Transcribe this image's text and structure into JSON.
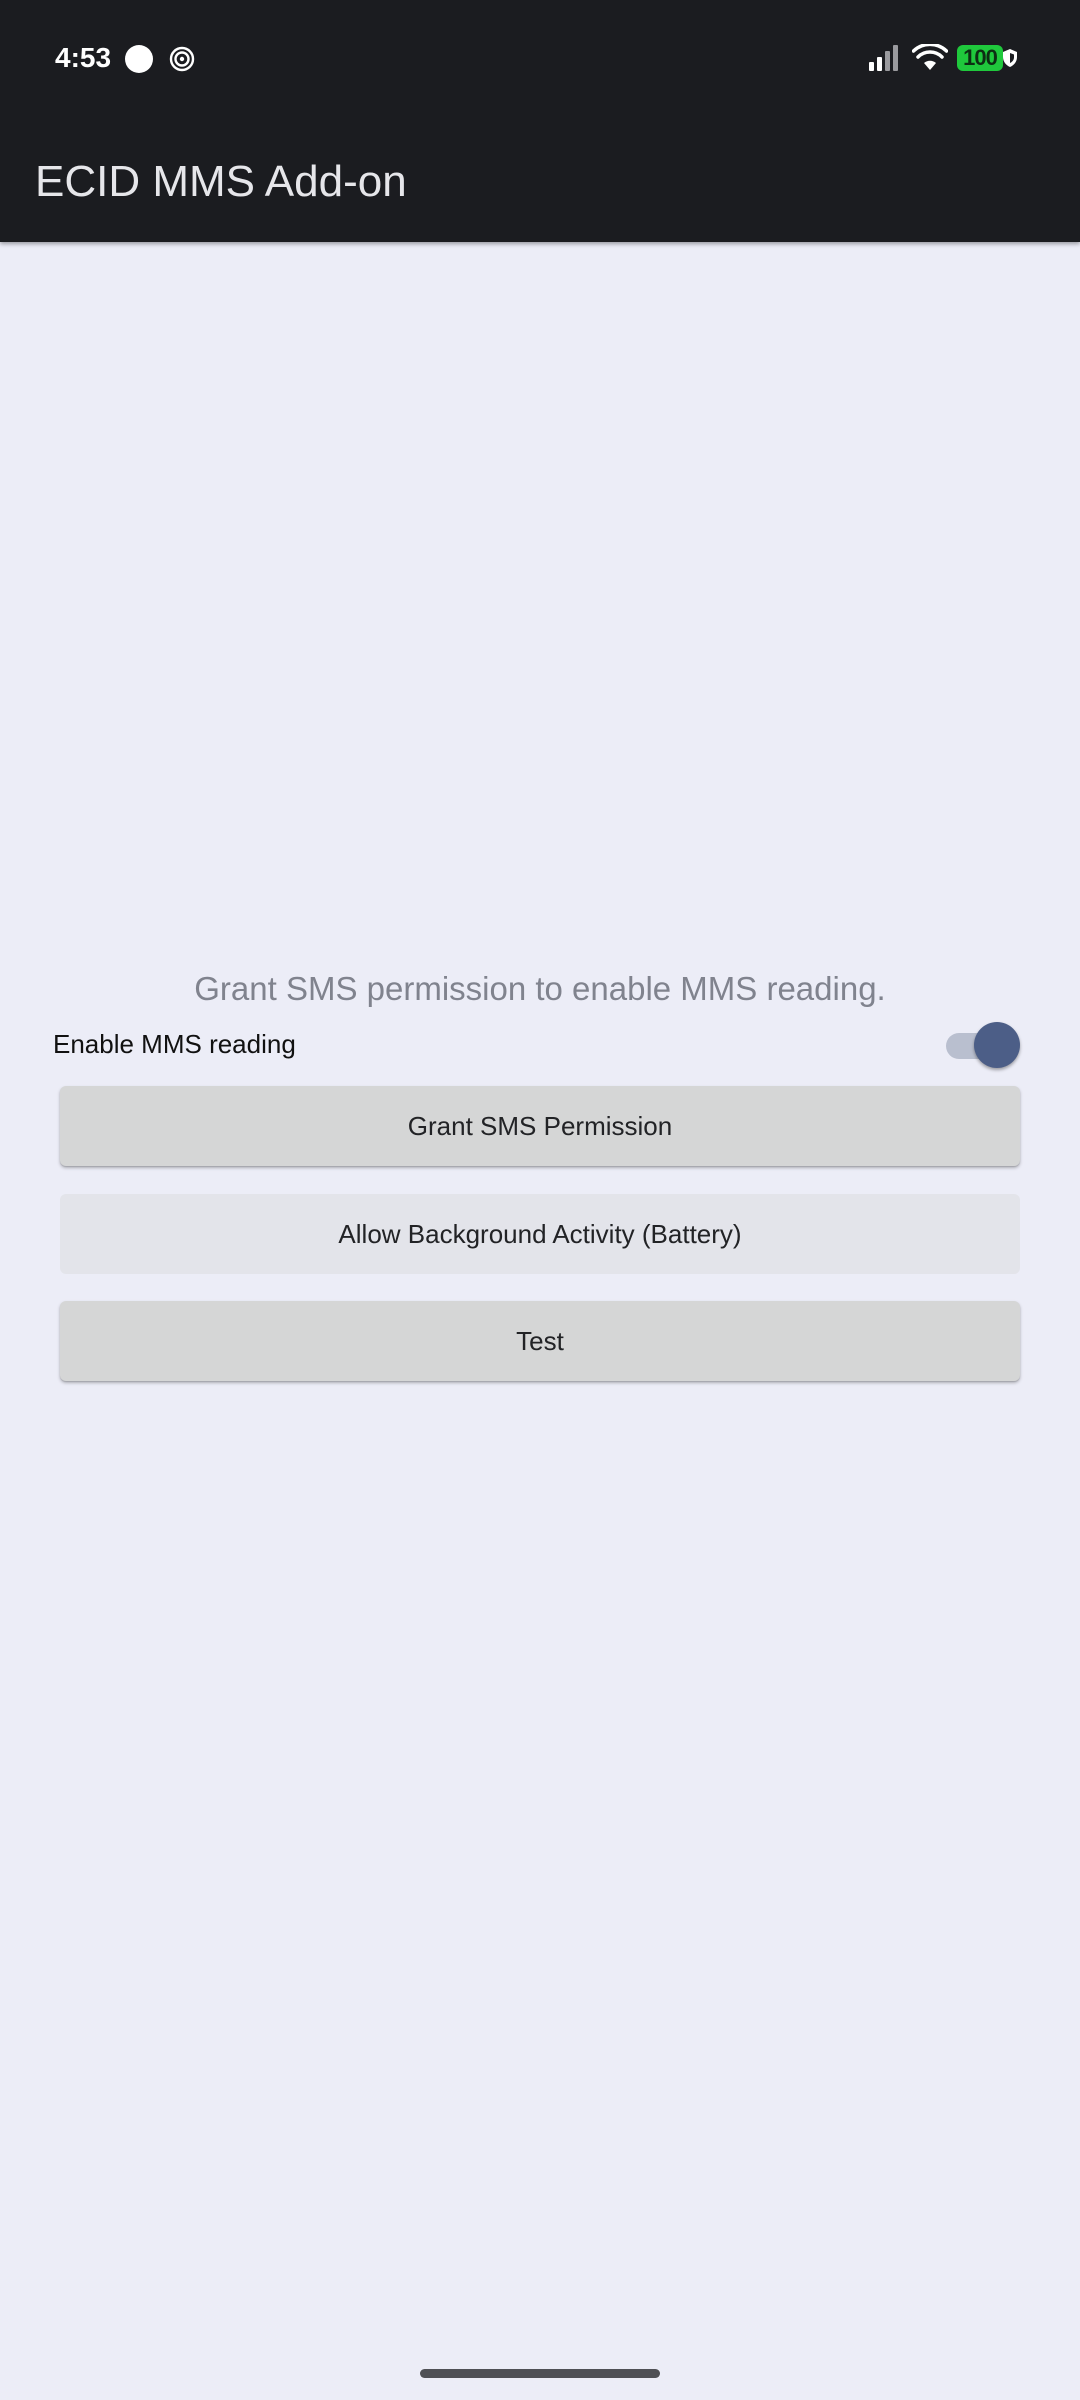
{
  "status_bar": {
    "time": "4:53",
    "battery_level": "100",
    "icons": [
      "notification-dot-icon",
      "spiral-icon",
      "signal-icon",
      "wifi-icon",
      "battery-icon",
      "shield-icon"
    ],
    "battery_color": "#1fc83c"
  },
  "app_bar": {
    "title": "ECID MMS Add-on",
    "background": "#1b1c20"
  },
  "main": {
    "hint_text": "Grant SMS permission to enable MMS reading.",
    "toggle": {
      "label": "Enable MMS reading",
      "checked": true,
      "accent_color": "#4c5e87"
    },
    "buttons": {
      "grant_sms": "Grant SMS Permission",
      "background_activity": "Allow Background Activity (Battery)",
      "test": "Test"
    },
    "background": "#ecedf7"
  }
}
